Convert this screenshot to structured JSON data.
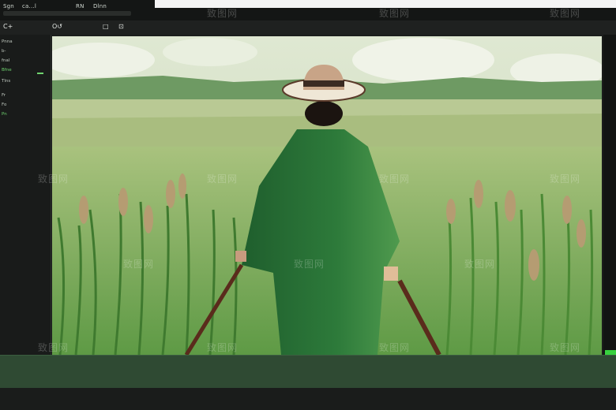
{
  "window": {
    "menu": [
      "Sgn",
      "ca...l",
      "RN",
      "Dlnn"
    ],
    "toolbar": [
      "C+",
      "O↺",
      "□",
      "⊡"
    ]
  },
  "left_panel": {
    "rows": [
      "Pnna",
      "b‑",
      "fnal",
      "Bfne",
      "Tlns",
      "Fr",
      "Fo",
      "Pn"
    ]
  },
  "watermark": {
    "text": "致图网"
  },
  "colors": {
    "accent": "#38d13f",
    "bottom_panel": "#2f4a33"
  }
}
